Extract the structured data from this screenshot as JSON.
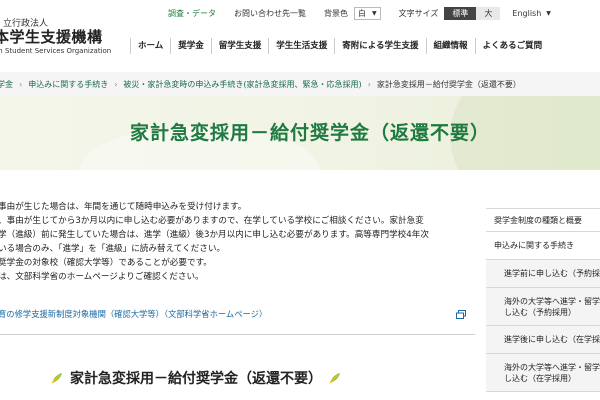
{
  "header": {
    "logo": {
      "line1": "立行政法人",
      "line2": "本学生支援機構",
      "line3": "an Student Services Organization"
    },
    "util": {
      "search_label": "調査・データ",
      "contact_label": "お問い合わせ先一覧",
      "bg_label": "背景色",
      "bg_value": "白",
      "size_label": "文字サイズ",
      "size_std": "標準",
      "size_lg": "大",
      "lang_label": "English"
    },
    "nav": [
      {
        "label": "ホーム"
      },
      {
        "label": "奨学金"
      },
      {
        "label": "留学生支援"
      },
      {
        "label": "学生生活支援"
      },
      {
        "label": "寄附による学生支援"
      },
      {
        "label": "組織情報"
      },
      {
        "label": "よくあるご質問"
      }
    ]
  },
  "breadcrumb": [
    {
      "label": "学金"
    },
    {
      "label": "申込みに関する手続き"
    },
    {
      "label": "被災・家計急変時の申込み手続き(家計急変採用、緊急・応急採用)"
    },
    {
      "label": "家計急変採用－給付奨学金（返還不要）"
    }
  ],
  "page": {
    "title": "家計急変採用－給付奨学金（返還不要）"
  },
  "content": {
    "lines": [
      "事由が生じた場合は、年間を通じて随時申込みを受け付けます。",
      "、事由が生じてから3か月以内に申し込む必要がありますので、在学している学校にご相談ください。家計急変",
      "学（進級）前に発生していた場合は、進学（進級）後3か月以内に申し込む必要があります。高等専門学校4年次",
      "いる場合のみ、「進学」を「進級」に読み替えてください。",
      "奨学金の対象校（確認大学等）であることが必要です。",
      "は、文部科学省のホームページよりご確認ください。"
    ],
    "link_text": "育の修学支援新制度対象機関（確認大学等）（文部科学省ホームページ）",
    "sub_heading": "家計急変採用－給付奨学金（返還不要）"
  },
  "sidebar": {
    "items": [
      {
        "label": "奨学金制度の種類と概要"
      },
      {
        "label": "申込みに関する手続き"
      },
      {
        "label": "進学前に申し込む（予約採"
      },
      {
        "label": "海外の大学等へ進学・留学し込む（予約採用）"
      },
      {
        "label": "進学後に申し込む（在学採"
      },
      {
        "label": "海外の大学等へ進学・留学し込む（在学採用）"
      }
    ]
  },
  "colors": {
    "accent_green": "#1e7a40",
    "link_blue": "#1a6aa0",
    "title_band": "#f2f4e6"
  }
}
